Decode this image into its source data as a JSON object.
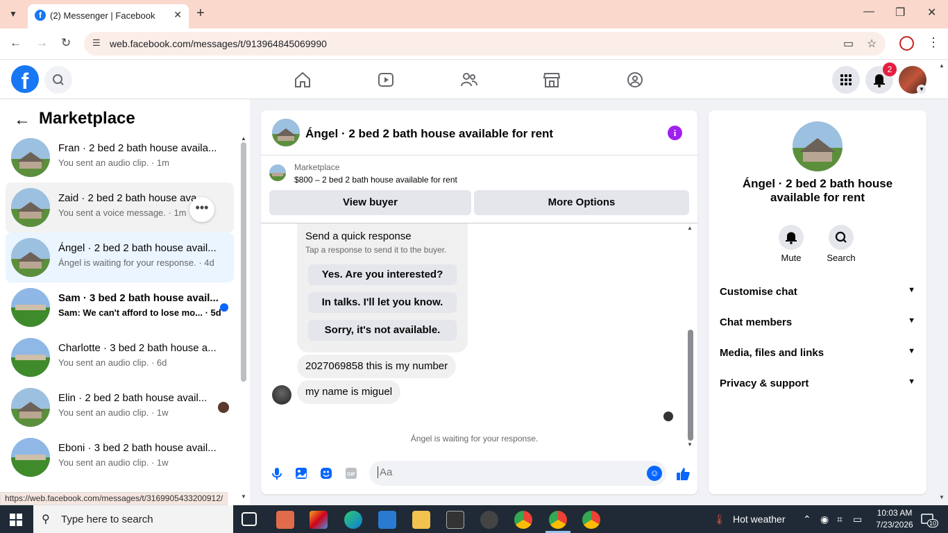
{
  "browser": {
    "tab_title": "(2) Messenger | Facebook",
    "url": "web.facebook.com/messages/t/913964845069990",
    "status_url": "https://web.facebook.com/messages/t/3169905433200912/"
  },
  "fb": {
    "notification_count": "2"
  },
  "left": {
    "title": "Marketplace",
    "conversations": [
      {
        "name": "Fran · 2 bed 2 bath house availa...",
        "sub": "You sent an audio clip. · 1m"
      },
      {
        "name": "Zaid · 2 bed 2 bath house ava...",
        "sub": "You sent a voice message. · 1m"
      },
      {
        "name": "Ángel · 2 bed 2 bath house avail...",
        "sub": "Ángel is waiting for your response. · 4d"
      },
      {
        "name": "Sam · 3 bed 2 bath house avail...",
        "sub": "Sam: We can't afford to lose mo... · 5d"
      },
      {
        "name": "Charlotte · 3 bed 2 bath house a...",
        "sub": "You sent an audio clip. · 6d"
      },
      {
        "name": "Elin · 2 bed 2 bath house avail...",
        "sub": "You sent an audio clip. · 1w"
      },
      {
        "name": "Eboni · 3 bed 2 bath house avail...",
        "sub": "You sent an audio clip. · 1w"
      }
    ]
  },
  "chat": {
    "title": "Ángel · 2 bed 2 bath house available for rent",
    "marketplace_label": "Marketplace",
    "listing": "$800 – 2 bed 2 bath house available for rent",
    "view_buyer": "View buyer",
    "more_options": "More Options",
    "quick_title": "Send a quick response",
    "quick_sub": "Tap a response to send it to the buyer.",
    "quick_options": [
      "Yes. Are you interested?",
      "In talks. I'll let you know.",
      "Sorry, it's not available."
    ],
    "messages": [
      "2027069858 this is my number",
      "my name is miguel"
    ],
    "waiting": "Ángel is waiting for your response.",
    "composer_placeholder": "Aa"
  },
  "right": {
    "name": "Ángel · 2 bed 2 bath house available for rent",
    "mute": "Mute",
    "search": "Search",
    "sections": [
      "Customise chat",
      "Chat members",
      "Media, files and links",
      "Privacy & support"
    ]
  },
  "taskbar": {
    "search_text": "Type here to search",
    "weather": "Hot weather",
    "time": "10:03 AM",
    "date": "7/23/2026",
    "notif_count": "10"
  }
}
